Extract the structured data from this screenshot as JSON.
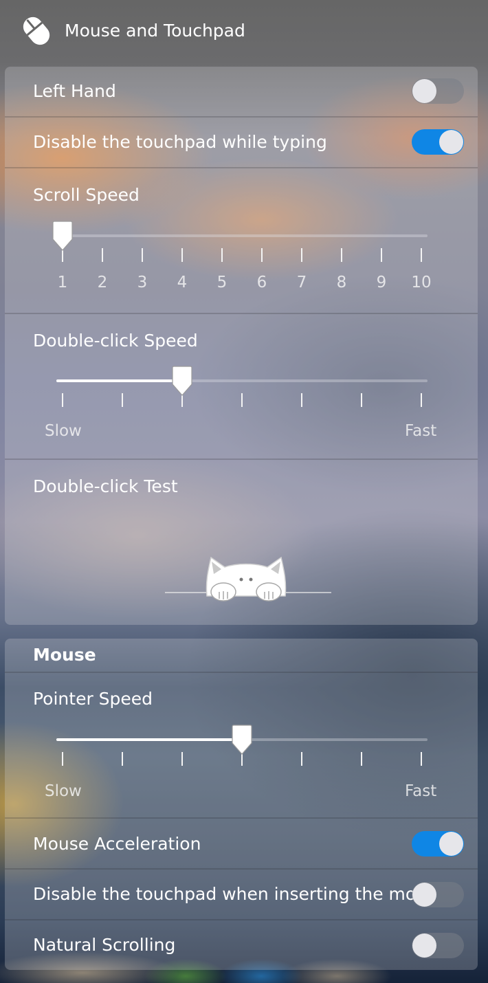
{
  "header": {
    "title": "Mouse and Touchpad",
    "icon": "mouse-icon"
  },
  "general": {
    "left_hand": {
      "label": "Left Hand",
      "enabled": false
    },
    "disable_touchpad_typing": {
      "label": "Disable the touchpad while typing",
      "enabled": true
    },
    "scroll_speed": {
      "label": "Scroll Speed",
      "value": 1,
      "min": 1,
      "max": 10,
      "tick_labels": [
        "1",
        "2",
        "3",
        "4",
        "5",
        "6",
        "7",
        "8",
        "9",
        "10"
      ]
    },
    "double_click_speed": {
      "label": "Double-click Speed",
      "value": 3,
      "min": 1,
      "max": 7,
      "slow_label": "Slow",
      "fast_label": "Fast"
    },
    "double_click_test": {
      "label": "Double-click Test",
      "icon": "cat-icon"
    }
  },
  "mouse": {
    "section_title": "Mouse",
    "pointer_speed": {
      "label": "Pointer Speed",
      "value": 4,
      "min": 1,
      "max": 7,
      "slow_label": "Slow",
      "fast_label": "Fast"
    },
    "mouse_acceleration": {
      "label": "Mouse Acceleration",
      "enabled": true
    },
    "disable_touchpad_on_mouse": {
      "label": "Disable the touchpad when inserting the mouse",
      "enabled": false
    },
    "natural_scrolling": {
      "label": "Natural Scrolling",
      "enabled": false
    }
  },
  "colors": {
    "accent": "#0f86e5",
    "toggle_off": "#7d828c",
    "knob": "#e6e6ea"
  }
}
